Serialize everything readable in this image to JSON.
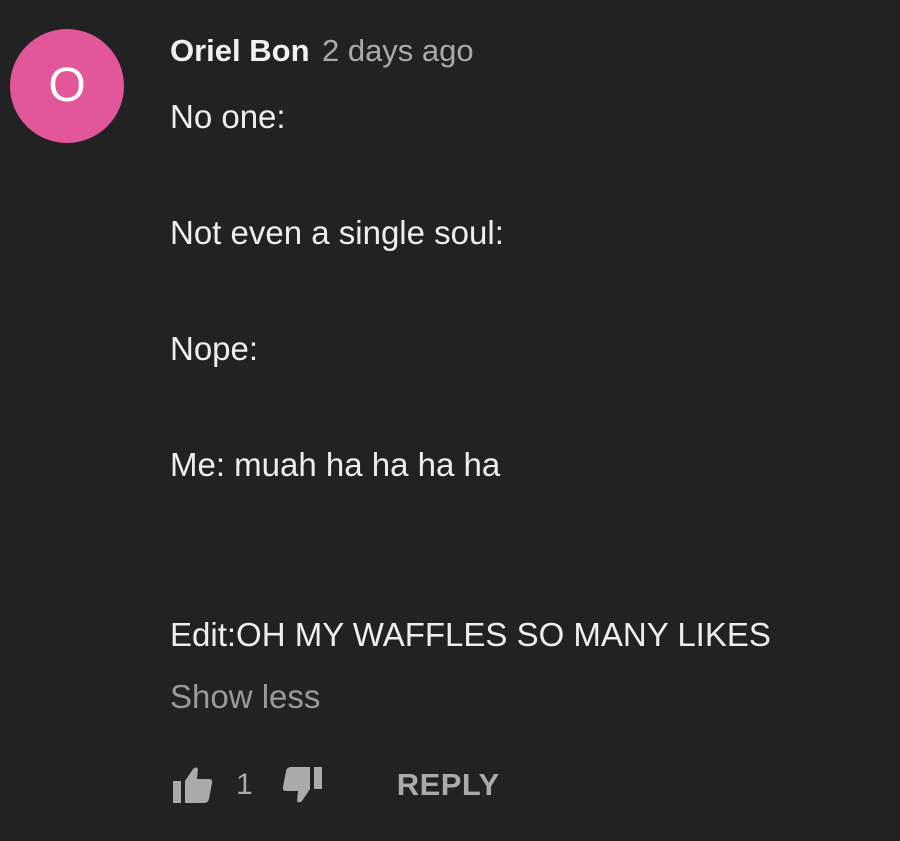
{
  "comment": {
    "avatar": {
      "letter": "O",
      "color": "#e2579a"
    },
    "author": "Oriel Bon",
    "timestamp": "2 days ago",
    "lines": [
      "No one:",
      "Not even a single soul:",
      "Nope:",
      "Me: muah ha ha ha ha",
      "Edit:OH MY WAFFLES SO MANY LIKES"
    ],
    "show_less_label": "Show less",
    "actions": {
      "like_icon": "thumbs-up-icon",
      "like_count": "1",
      "dislike_icon": "thumbs-down-icon",
      "reply_label": "REPLY"
    }
  }
}
